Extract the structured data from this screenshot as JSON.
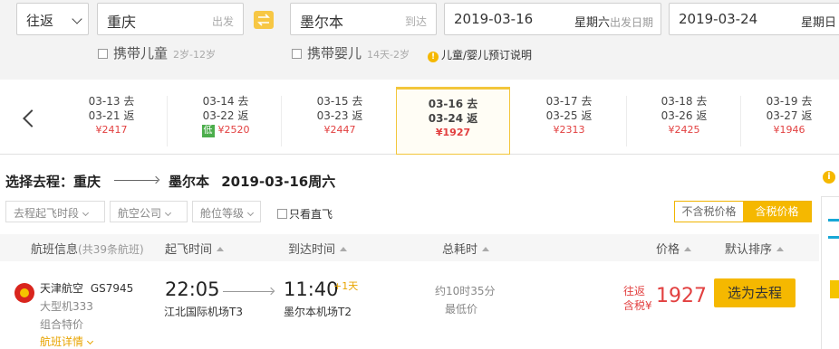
{
  "search": {
    "trip_type": "往返",
    "from_city": "重庆",
    "from_hint": "出发",
    "to_city": "墨尔本",
    "to_hint": "到达",
    "depart_date": "2019-03-16",
    "depart_weekday": "星期六",
    "depart_hint": "出发日期",
    "return_date": "2019-03-24",
    "return_weekday": "星期日",
    "child_label": "携带儿童",
    "child_age": "2岁-12岁",
    "infant_label": "携带婴儿",
    "infant_age": "14天-2岁",
    "booking_note": "儿童/婴儿预订说明"
  },
  "dates": [
    {
      "go": "03-13 去",
      "back": "03-21 返",
      "price": "¥2417"
    },
    {
      "go": "03-14 去",
      "back": "03-22 返",
      "price": "¥2520",
      "badge": "低"
    },
    {
      "go": "03-15 去",
      "back": "03-23 返",
      "price": "¥2447"
    },
    {
      "go": "03-16 去",
      "back": "03-24 返",
      "price": "¥1927"
    },
    {
      "go": "03-17 去",
      "back": "03-25 返",
      "price": "¥2313"
    },
    {
      "go": "03-18 去",
      "back": "03-26 返",
      "price": "¥2425"
    },
    {
      "go": "03-19 去",
      "back": "03-27 返",
      "price": "¥1946"
    }
  ],
  "heading": {
    "prefix": "选择去程：重庆",
    "dest": "墨尔本",
    "date": "2019-03-16周六"
  },
  "filters": {
    "depart_time": "去程起飞时段",
    "airline": "航空公司",
    "cabin": "舱位等级",
    "direct_only": "只看直飞",
    "tax_excl": "不含税价格",
    "tax_incl": "含税价格"
  },
  "columns": {
    "flight_info": "航班信息",
    "flight_count": "(共39条航班)",
    "depart_time": "起飞时间",
    "arrive_time": "到达时间",
    "duration": "总耗时",
    "price": "价格",
    "sort": "默认排序"
  },
  "flight": {
    "airline": "天津航空",
    "flight_no": "GS7945",
    "aircraft": "大型机333",
    "combo": "组合特价",
    "details": "航班详情",
    "depart_time": "22:05",
    "depart_airport": "江北国际机场T3",
    "arrive_time": "11:40",
    "day_offset": "+1天",
    "arrive_airport": "墨尔本机场T2",
    "duration": "约10时35分",
    "tag": "最低价",
    "price_line1": "往返",
    "price_line2": "含税",
    "currency": "¥",
    "price": "1927",
    "select_label": "选为去程"
  },
  "colors": {
    "accent": "#f5b800",
    "price_red": "#e24040"
  }
}
